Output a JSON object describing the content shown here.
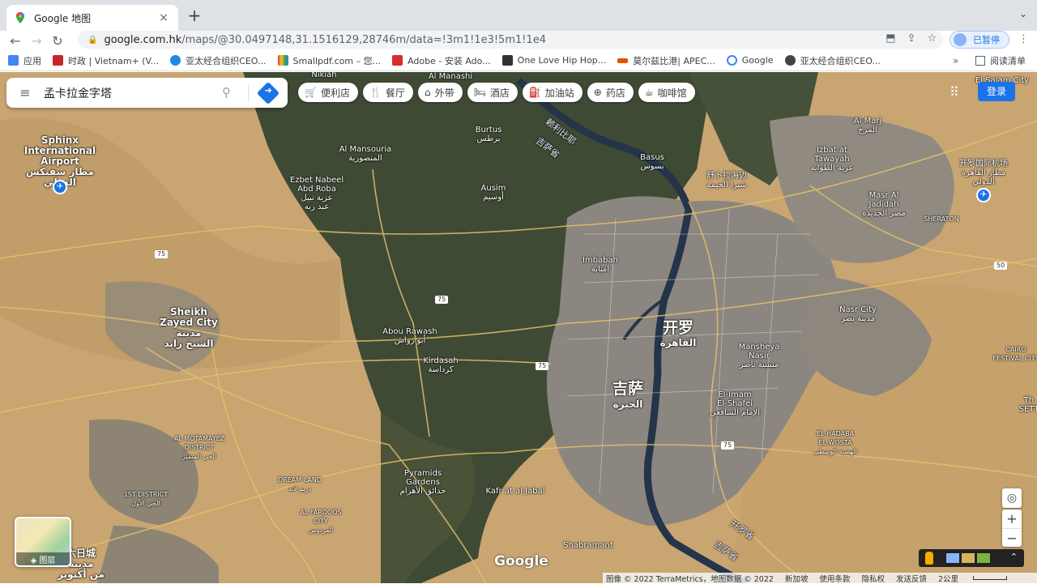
{
  "browser": {
    "tab_title": "Google 地图",
    "tab_close": "×",
    "new_tab": "+",
    "tab_menu": "⌄",
    "back": "←",
    "forward": "→",
    "reload": "↻",
    "url_host": "google.com.hk",
    "url_path": "/maps/@30.0497148,31.1516129,28746m/data=!3m1!1e3!5m1!1e4",
    "profile_label": "已暂停",
    "kebab": "⋮",
    "bookmarks": [
      {
        "label": "应用",
        "color": "#4285f4"
      },
      {
        "label": "时政 | Vietnam+ (V...",
        "color": "#c62828"
      },
      {
        "label": "亚太经合组织CEO...",
        "color": "#1e88e5"
      },
      {
        "label": "Smallpdf.com – 您...",
        "color": "#e53935"
      },
      {
        "label": "Adobe - 安装 Ado...",
        "color": "#d32f2f"
      },
      {
        "label": "One Love Hip Hop...",
        "color": "#333333"
      },
      {
        "label": "莫尔兹比港| APEC...",
        "color": "#e65100"
      },
      {
        "label": "Google",
        "color": "#4285f4"
      },
      {
        "label": "亚太经合组织CEO...",
        "color": "#444444"
      }
    ],
    "bookmarks_more": "»",
    "reading_list": "阅读清单"
  },
  "maps": {
    "search_value": "孟卡拉金字塔",
    "menu_icon": "≡",
    "search_icon": "⚲",
    "directions_icon": "➜",
    "chips": [
      {
        "icon": "🛒",
        "label": "便利店"
      },
      {
        "icon": "🍴",
        "label": "餐厅"
      },
      {
        "icon": "⌂",
        "label": "外带"
      },
      {
        "icon": "🛏",
        "label": "酒店"
      },
      {
        "icon": "⛽",
        "label": "加油站"
      },
      {
        "icon": "⊕",
        "label": "药店"
      },
      {
        "icon": "☕",
        "label": "咖啡馆"
      }
    ],
    "apps_icon": "⠿",
    "signin": "登录",
    "layers_label": "◈ 图层",
    "locate_icon": "◎",
    "zoom_in": "+",
    "zoom_out": "−",
    "expand_icon": "⌃",
    "google_logo": "Google",
    "footer": {
      "imagery": "图像 © 2022 TerraMetrics，地图数据 © 2022",
      "new_zealand": "新加坡",
      "terms": "使用条款",
      "privacy": "隐私权",
      "feedback": "发送反馈",
      "scale": "2公里"
    },
    "labels": {
      "nikiah": "Nikiah",
      "almanashi": "Al Manashi",
      "elsalam": "El Salam City",
      "sphinx": "Sphinx\nInternational\nAirport\nمطار سفنكس\nالدولي",
      "nile1": "赖利比耶",
      "nile2": "吉萨省",
      "burtus": "Burtus\nبرطس",
      "almansouria": "Al Mansouria\nالمنصورية",
      "ezbet": "Ezbet Nabeel\nAbd Roba\nعزبة نبيل\nعبد ربه",
      "ausim": "Ausim\nأوسيم",
      "basus": "Basus\nبسوس",
      "shubra": "舒卜拉海迈\nشبرا الخيمة",
      "almarj": "Al Marj\nالمرج",
      "izbat": "Izbat at\nTawayah\nعزبة الطوايه",
      "cairo_airport": "开罗国际机场\nمطار القاهرة\nالدولي",
      "masr": "Masr Al\nJadidah\nمصر الجديدة",
      "sheraton": "SHERATON",
      "imbabah": "Imbabah\nامبابة",
      "sheikh": "Sheikh\nZayed City\nمدينة\nالشيخ زايد",
      "abou": "Abou Rawash\nأبو رواش",
      "cairo": "开罗",
      "cairo_ar": "القاهرة",
      "nasr": "Nasr City\nمدينة نصر",
      "mansheya": "Mansheya\nNasir\nمنشية ناصر",
      "cairo_fest": "CAIRO\nFESTIVAL CITY",
      "kirdasah": "Kirdasah\nكرداسة",
      "giza": "吉萨",
      "giza_ar": "الجيزة",
      "elimam": "El-Imam\nEl-Shafei\nالإمام الشافعي",
      "almotamayez": "AL MOTAMAYEZ\nDISTRICT\nالحي المتميز",
      "elhadaba": "EL-HADABA\nEL-WOSTA\nالهضبة الوسطى",
      "the_sett": "Th\nSETT",
      "pyramids": "Pyramids\nGardens\nحدائق الأهرام",
      "dreamland": "DREAM LAND\nدريم لاند",
      "kafrat": "Kafr at al Jabal",
      "first_district": "1ST DISTRICT\nالحي الأول",
      "alfardous": "AL FARDOOS\nCITY\nالفردوس",
      "shabramant": "Shabramant",
      "october": "六日城\nمدينة\nمن أكتوبر",
      "nile_south": "开罗省",
      "nile_south2": "吉萨省"
    },
    "shields": [
      "75",
      "75",
      "75",
      "75",
      "50"
    ],
    "colors": {
      "desert": "#c9a572",
      "farmland": "#3f4a34",
      "city": "#8b8680",
      "river": "#24344a",
      "road": "#e2c16c",
      "accent": "#1a73e8"
    }
  }
}
